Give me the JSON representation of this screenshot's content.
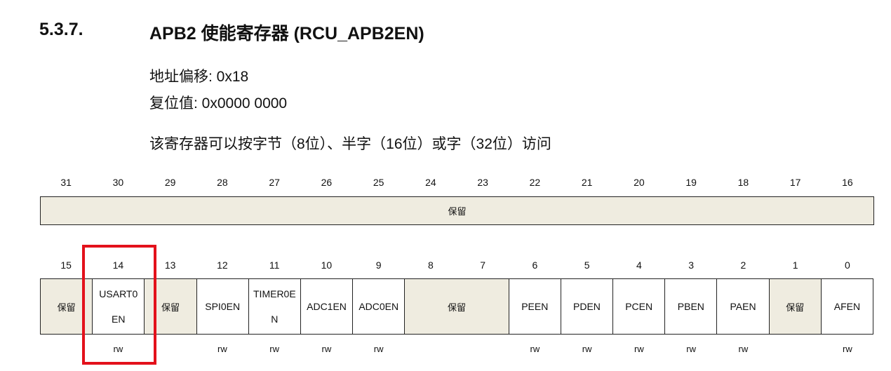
{
  "section": {
    "number": "5.3.7.",
    "title": "APB2 使能寄存器 (RCU_APB2EN)"
  },
  "info": {
    "offset": "地址偏移: 0x18",
    "reset": "复位值: 0x0000 0000",
    "access_note": "该寄存器可以按字节（8位）、半字（16位）或字（32位）访问"
  },
  "upper_bits": [
    "31",
    "30",
    "29",
    "28",
    "27",
    "26",
    "25",
    "24",
    "23",
    "22",
    "21",
    "20",
    "19",
    "18",
    "17",
    "16"
  ],
  "upper_reserved": "保留",
  "lower_bits": [
    "15",
    "14",
    "13",
    "12",
    "11",
    "10",
    "9",
    "8",
    "7",
    "6",
    "5",
    "4",
    "3",
    "2",
    "1",
    "0"
  ],
  "fields": [
    {
      "name": "保留"
    },
    {
      "name_line1": "USART0",
      "name_line2": "EN"
    },
    {
      "name": "保留"
    },
    {
      "name": "SPI0EN"
    },
    {
      "name_line1": "TIMER0E",
      "name_line2": "N"
    },
    {
      "name": "ADC1EN"
    },
    {
      "name": "ADC0EN"
    },
    {
      "name": "保留"
    },
    {
      "name": "PEEN"
    },
    {
      "name": "PDEN"
    },
    {
      "name": "PCEN"
    },
    {
      "name": "PBEN"
    },
    {
      "name": "PAEN"
    },
    {
      "name": "保留"
    },
    {
      "name": "AFEN"
    }
  ],
  "access": [
    "",
    "rw",
    "",
    "rw",
    "rw",
    "rw",
    "rw",
    "",
    "",
    "rw",
    "rw",
    "rw",
    "rw",
    "rw",
    "",
    "rw"
  ],
  "highlight_color": "#e3111b",
  "reserved_color": "#efece0"
}
